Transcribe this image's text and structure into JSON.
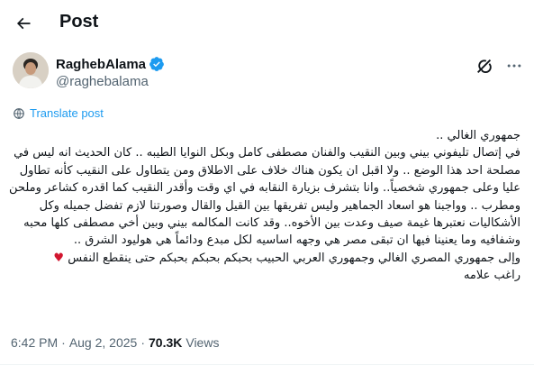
{
  "header": {
    "title": "Post",
    "back_icon": "arrow-left-icon"
  },
  "author": {
    "display_name": "RaghebAlama",
    "handle": "@raghebalama",
    "verified_icon": "verified-badge-icon",
    "verified_color": "#1d9bf0",
    "grok_icon": "grok-icon",
    "more_icon": "more-horizontal-icon"
  },
  "translate": {
    "label": "Translate post",
    "icon": "globe-icon",
    "color": "#1d9bf0"
  },
  "post": {
    "lines": [
      "جمهوري الغالي ..",
      "في إتصال تليفوني بيني وبين النقيب والفنان مصطفى كامل وبكل النوايا الطيبه .. كان الحديث انه ليس في",
      "مصلحة احد هذا الوضع .. ولا اقبل ان يكون هناك خلاف على الاطلاق ومن يتطاول على النقيب كأنه تطاول",
      "عليا وعلى جمهوري شخصياً.. وانا بتشرف بزيارة النقابه في اي وقت وأقدر النقيب كما اقدره كشاعر وملحن",
      "ومطرب .. وواجبنا هو اسعاد الجماهير وليس تفريقها بين القيل والقال وصورتنا لازم تفضل جميله وكل",
      "الأشكاليات نعتبرها غيمة صيف وعدت بين الأخوه.. وقد كانت المكالمه بيني وبين أخي مصطفى كلها محبه",
      "وشفافيه وما يعنينا فيها ان تبقى مصر هي وجهه اساسيه لكل مبدع ودائماً هي هوليود الشرق ..",
      "وإلى جمهوري المصري الغالي وجمهوري العربي الحبيب بحبكم بحبكم بحبكم حتى ينقطع النفس",
      "راغب علامه"
    ],
    "heart_emoji": "♥",
    "heart_color": "#d2162f"
  },
  "meta": {
    "time": "6:42 PM",
    "separator": "·",
    "date": "Aug 2, 2025",
    "views_count": "70.3K",
    "views_label": "Views"
  }
}
